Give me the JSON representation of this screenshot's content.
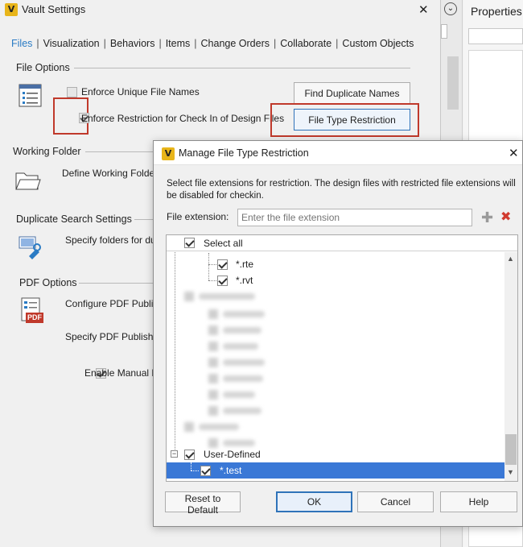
{
  "vault": {
    "title": "Vault Settings",
    "tabs": [
      "Files",
      "Visualization",
      "Behaviors",
      "Items",
      "Change Orders",
      "Collaborate",
      "Custom Objects"
    ],
    "file_options": {
      "label": "File Options",
      "enforce_unique": "Enforce Unique File Names",
      "enforce_restriction": "Enforce Restriction for Check In of Design Files",
      "find_duplicates_btn": "Find Duplicate Names",
      "file_type_restriction_btn": "File Type Restriction"
    },
    "working_folder": {
      "label": "Working Folder",
      "define": "Define Working Folde"
    },
    "duplicate_search": {
      "label": "Duplicate Search Settings",
      "specify": "Specify folders for du"
    },
    "pdf_options": {
      "label": "PDF Options",
      "configure": "Configure PDF Publis",
      "specify": "Specify PDF Publish l",
      "enable_manual": "Enable Manual P",
      "pdf_badge": "PDF"
    }
  },
  "properties": {
    "title": "Properties"
  },
  "dialog": {
    "title": "Manage File Type Restriction",
    "description": "Select file extensions for restriction. The design files with restricted file extensions will be disabled for checkin.",
    "extension_label": "File extension:",
    "extension_placeholder": "Enter the file extension",
    "select_all": "Select all",
    "items": [
      "*.rte",
      "*.rvt"
    ],
    "user_defined": "User-Defined",
    "selected_item": "*.test",
    "buttons": {
      "reset": "Reset to Default",
      "ok": "OK",
      "cancel": "Cancel",
      "help": "Help"
    }
  },
  "icons": {
    "app": "vault-logo-icon",
    "close": "close-icon",
    "add": "plus-icon",
    "delete": "red-x-icon",
    "collapse": "double-chevron-icon"
  },
  "colors": {
    "accent": "#2a7bc4",
    "highlight_border": "#c0392b",
    "selection": "#3a78d6",
    "vault_yellow": "#e8b51a"
  }
}
